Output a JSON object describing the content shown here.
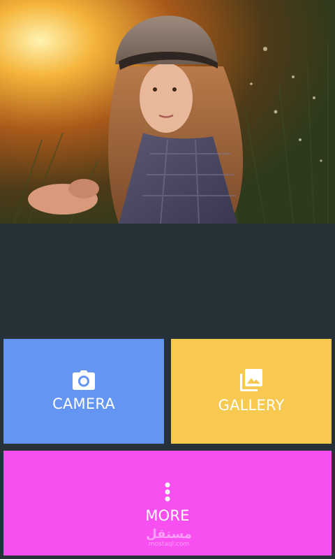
{
  "colors": {
    "background": "#263238",
    "camera_tile": "#6495f2",
    "gallery_tile": "#f7c951",
    "more_tile": "#f84ff0",
    "tile_text": "#ffffff"
  },
  "hero": {
    "image": "photo-girl-in-cap-sunlit-field"
  },
  "tiles": {
    "camera": {
      "label": "CAMERA",
      "icon": "camera-icon"
    },
    "gallery": {
      "label": "GALLERY",
      "icon": "gallery-icon"
    },
    "more": {
      "label": "MORE",
      "icon": "more-vertical-icon"
    }
  },
  "watermark": {
    "main": "مستقل",
    "sub": "mostaql.com"
  }
}
